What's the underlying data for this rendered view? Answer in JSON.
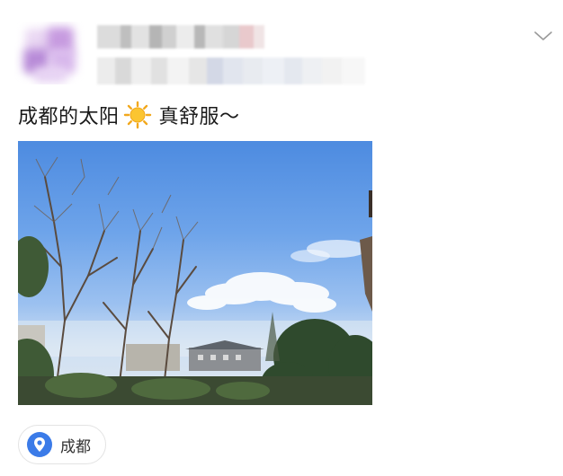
{
  "post": {
    "text_part1": "成都的太阳",
    "emoji": "sun-emoji",
    "text_part2": "真舒服～",
    "photo_alt": "photo",
    "location": "成都"
  },
  "icons": {
    "more": "chevron-down-icon",
    "location": "location-pin-icon"
  },
  "colors": {
    "accent": "#3b7be8",
    "text": "#1a1a1a",
    "chip_border": "#e3e3e3"
  }
}
